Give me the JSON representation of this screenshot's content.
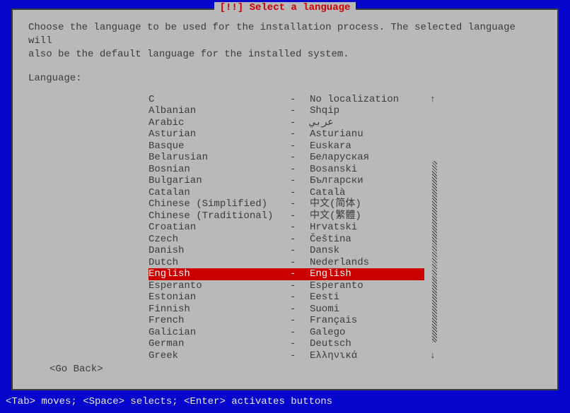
{
  "title": "[!!] Select a language",
  "prompt": "Choose the language to be used for the installation process. The selected language will\nalso be the default language for the installed system.",
  "label": "Language:",
  "languages": [
    {
      "name": "C",
      "sep": "-",
      "native": "No localization",
      "selected": false
    },
    {
      "name": "Albanian",
      "sep": "-",
      "native": "Shqip",
      "selected": false
    },
    {
      "name": "Arabic",
      "sep": "-",
      "native": "عربي",
      "selected": false
    },
    {
      "name": "Asturian",
      "sep": "-",
      "native": "Asturianu",
      "selected": false
    },
    {
      "name": "Basque",
      "sep": "-",
      "native": "Euskara",
      "selected": false
    },
    {
      "name": "Belarusian",
      "sep": "-",
      "native": "Беларуская",
      "selected": false
    },
    {
      "name": "Bosnian",
      "sep": "-",
      "native": "Bosanski",
      "selected": false
    },
    {
      "name": "Bulgarian",
      "sep": "-",
      "native": "Български",
      "selected": false
    },
    {
      "name": "Catalan",
      "sep": "-",
      "native": "Català",
      "selected": false
    },
    {
      "name": "Chinese (Simplified)",
      "sep": "-",
      "native": "中文(简体)",
      "selected": false
    },
    {
      "name": "Chinese (Traditional)",
      "sep": "-",
      "native": "中文(繁體)",
      "selected": false
    },
    {
      "name": "Croatian",
      "sep": "-",
      "native": "Hrvatski",
      "selected": false
    },
    {
      "name": "Czech",
      "sep": "-",
      "native": "Čeština",
      "selected": false
    },
    {
      "name": "Danish",
      "sep": "-",
      "native": "Dansk",
      "selected": false
    },
    {
      "name": "Dutch",
      "sep": "-",
      "native": "Nederlands",
      "selected": false
    },
    {
      "name": "English",
      "sep": "-",
      "native": "English",
      "selected": true
    },
    {
      "name": "Esperanto",
      "sep": "-",
      "native": "Esperanto",
      "selected": false
    },
    {
      "name": "Estonian",
      "sep": "-",
      "native": "Eesti",
      "selected": false
    },
    {
      "name": "Finnish",
      "sep": "-",
      "native": "Suomi",
      "selected": false
    },
    {
      "name": "French",
      "sep": "-",
      "native": "Français",
      "selected": false
    },
    {
      "name": "Galician",
      "sep": "-",
      "native": "Galego",
      "selected": false
    },
    {
      "name": "German",
      "sep": "-",
      "native": "Deutsch",
      "selected": false
    },
    {
      "name": "Greek",
      "sep": "-",
      "native": "Ελληνικά",
      "selected": false
    }
  ],
  "goback": "<Go Back>",
  "hintbar": "<Tab> moves; <Space> selects; <Enter> activates buttons",
  "arrows": {
    "up": "↑",
    "down": "↓"
  }
}
